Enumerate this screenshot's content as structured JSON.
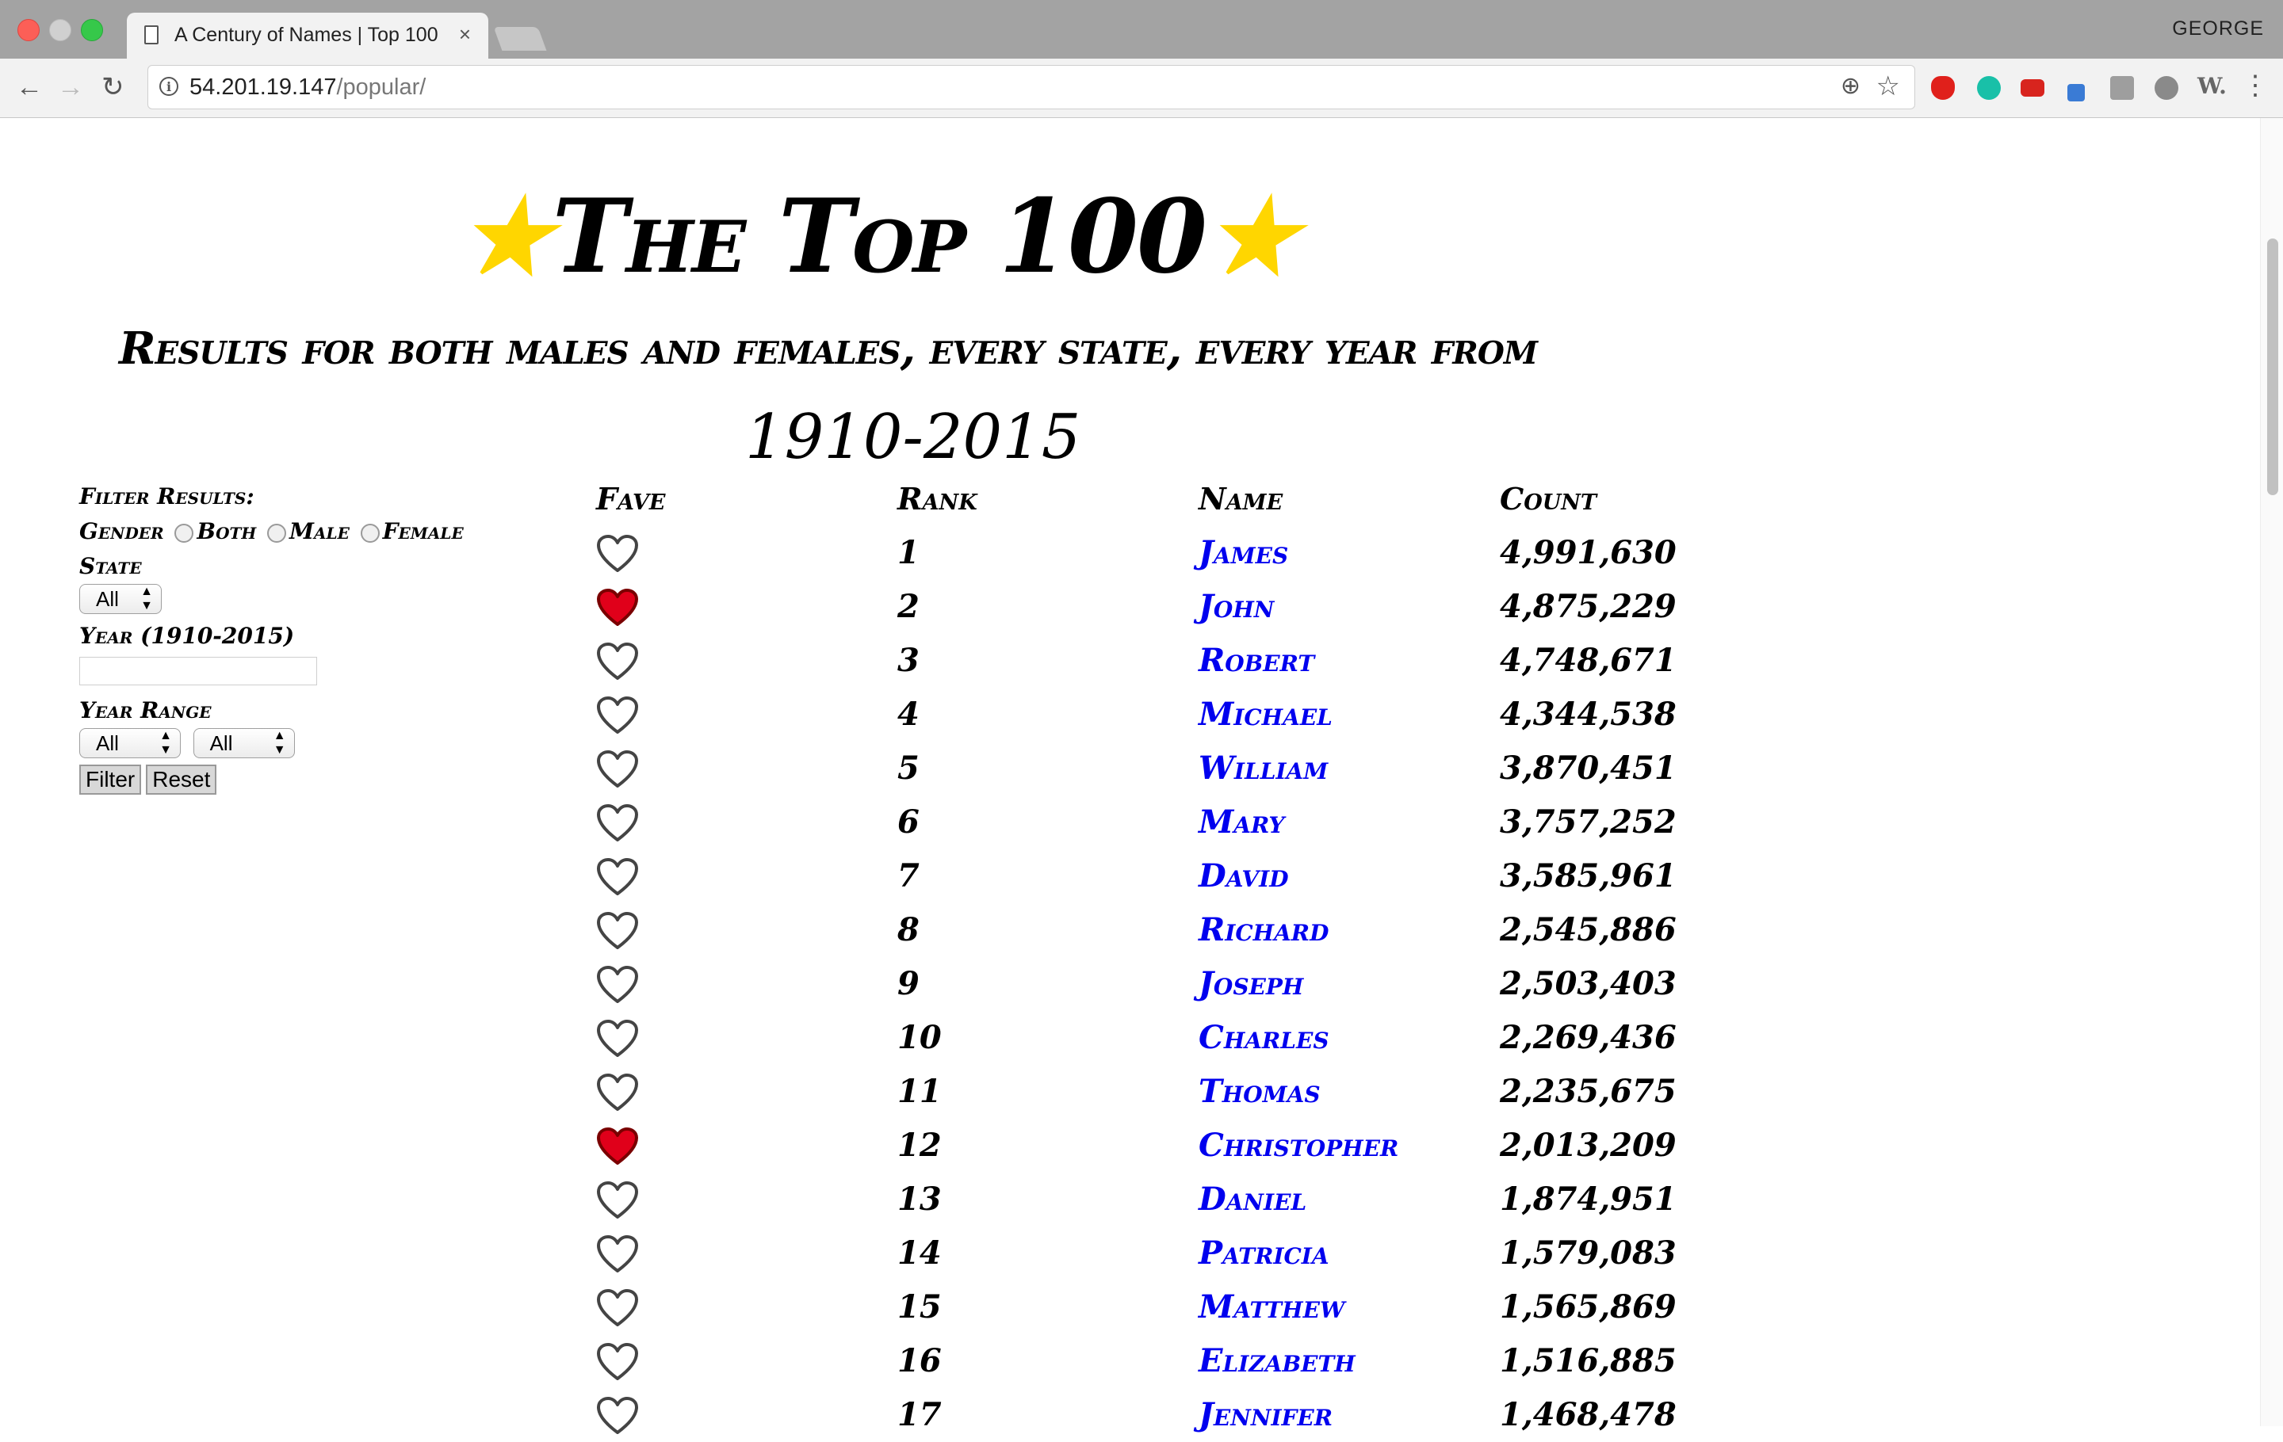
{
  "browser": {
    "tab_title": "A Century of Names | Top 100",
    "tab_close": "×",
    "profile_name": "GEORGE",
    "url_host": "54.201.19.147",
    "url_path": "/popular/",
    "info_icon": "i",
    "zoom_icon": "⊕",
    "star_icon": "☆",
    "menu_icon": "⋮",
    "back_icon": "←",
    "forward_icon": "→",
    "reload_icon": "↻",
    "ext_label": "W."
  },
  "header": {
    "title": "The Top 100",
    "star_glyph": "★",
    "subtitle": "Results for both males and females, every state, every year from",
    "years": "1910-2015"
  },
  "filter": {
    "heading": "Filter Results:",
    "gender_label": "Gender",
    "gender_options": [
      "Both",
      "Male",
      "Female"
    ],
    "state_label": "State",
    "state_value": "All",
    "year_label": "Year (1910-2015)",
    "year_value": "",
    "range_label": "Year Range",
    "range_from": "All",
    "range_to": "All",
    "filter_button": "Filter",
    "reset_button": "Reset"
  },
  "table": {
    "headers": {
      "fave": "Fave",
      "rank": "Rank",
      "name": "Name",
      "count": "Count"
    },
    "rows": [
      {
        "rank": "1",
        "name": "James",
        "count": "4,991,630",
        "fave": false
      },
      {
        "rank": "2",
        "name": "John",
        "count": "4,875,229",
        "fave": true
      },
      {
        "rank": "3",
        "name": "Robert",
        "count": "4,748,671",
        "fave": false
      },
      {
        "rank": "4",
        "name": "Michael",
        "count": "4,344,538",
        "fave": false
      },
      {
        "rank": "5",
        "name": "William",
        "count": "3,870,451",
        "fave": false
      },
      {
        "rank": "6",
        "name": "Mary",
        "count": "3,757,252",
        "fave": false
      },
      {
        "rank": "7",
        "name": "David",
        "count": "3,585,961",
        "fave": false
      },
      {
        "rank": "8",
        "name": "Richard",
        "count": "2,545,886",
        "fave": false
      },
      {
        "rank": "9",
        "name": "Joseph",
        "count": "2,503,403",
        "fave": false
      },
      {
        "rank": "10",
        "name": "Charles",
        "count": "2,269,436",
        "fave": false
      },
      {
        "rank": "11",
        "name": "Thomas",
        "count": "2,235,675",
        "fave": false
      },
      {
        "rank": "12",
        "name": "Christopher",
        "count": "2,013,209",
        "fave": true
      },
      {
        "rank": "13",
        "name": "Daniel",
        "count": "1,874,951",
        "fave": false
      },
      {
        "rank": "14",
        "name": "Patricia",
        "count": "1,579,083",
        "fave": false
      },
      {
        "rank": "15",
        "name": "Matthew",
        "count": "1,565,869",
        "fave": false
      },
      {
        "rank": "16",
        "name": "Elizabeth",
        "count": "1,516,885",
        "fave": false
      },
      {
        "rank": "17",
        "name": "Jennifer",
        "count": "1,468,478",
        "fave": false
      }
    ]
  },
  "colors": {
    "star": "#ffd600",
    "link": "#0000ee",
    "heart_fave": "#e0001a",
    "heart_outline": "#444444"
  }
}
